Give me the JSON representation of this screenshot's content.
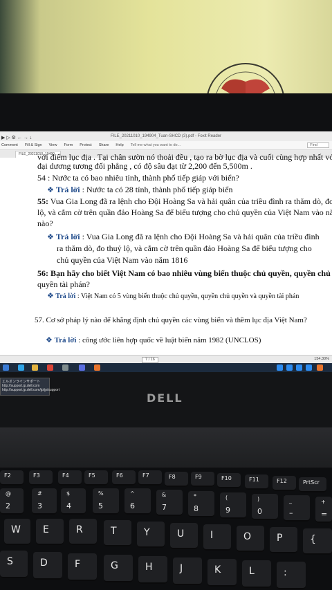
{
  "window": {
    "title": "FILE_20211010_194904_Tuan-SHCD (3).pdf - Foxit Reader",
    "quick_access": "▶ ▷ ⚙ ← → ↓",
    "ribbon_items": [
      "Comment",
      "Fill & Sign",
      "View",
      "Form",
      "Protect",
      "Share",
      "Help"
    ],
    "tell_me": "Tell me what you want to do...",
    "find_placeholder": "Find",
    "tab_label": "FILE_20211010_19490..."
  },
  "document": {
    "line1": "với điểm lục địa . Tại chân sườn nó thoải đều , tạo ra bờ lục địa và cuối cùng hợp nhất với đáy",
    "line2": "đại dương tương đối phẳng , có độ sâu đạt từ 2,200 đến 5,500m .",
    "q54": "54 : Nước ta có bao nhiêu tỉnh, thành phố tiếp giáp với biển?",
    "answer_label": "Trả lời",
    "a54": ": Nước ta có 28 tỉnh, thành phố tiếp giáp biển",
    "q55_num": "55:",
    "q55_l1": "Vua Gia Long đã ra lệnh cho Đội Hoàng Sa và hải quân của triều đình ra thăm dò, đo thuỷ",
    "q55_l2": "lộ, và cắm cờ trên quần đảo Hoàng Sa để biểu tượng cho chủ quyền của Việt Nam vào năm",
    "q55_l3": "nào?",
    "a55_l1": ": Vua Gia Long đã ra lệnh cho Đội Hoàng Sa và hải quân của triều đình",
    "a55_l2": "ra thăm dò, đo thuỷ lộ, và cắm cờ trên quần đảo Hoàng Sa để biểu tượng cho",
    "a55_l3": "chủ quyền của Việt Nam vào năm 1816",
    "q56_l1": "56: Bạn hãy cho biết Việt Nam có bao nhiêu vùng biển thuộc chủ quyền, quyền chủ quyền và",
    "q56_l2": "quyền tài phán?",
    "a56": ": Việt Nam có 5 vùng biển thuộc chủ quyền, quyền chủ quyền và quyền tài phán",
    "q57": "57. Cơ sở pháp lý nào để khẳng định chủ quyền các vùng biển và thềm lục địa Việt Nam?",
    "a57": ": công ước liên hợp quốc về luật biển năm 1982 (UNCLOS)",
    "bullet_glyph": "❖"
  },
  "status": {
    "page": "7 / 16",
    "zoom": "154.30%"
  },
  "popup": {
    "line1": "エルオンラインサポート",
    "line2": "http://support.jp.dell.com",
    "line3": "http://support.jp.dell.com/jp/jp/support"
  },
  "brand": "DELL",
  "keyboard": {
    "fn_row": [
      "F2",
      "F3",
      "F4",
      "F5",
      "F6",
      "F7",
      "F8",
      "F9",
      "F10",
      "F11",
      "F12",
      "PrtScr"
    ],
    "num_row": [
      [
        "@",
        "2"
      ],
      [
        "#",
        "3"
      ],
      [
        "$",
        "4"
      ],
      [
        "%",
        "5"
      ],
      [
        "^",
        "6"
      ],
      [
        "&",
        "7"
      ],
      [
        "*",
        "8"
      ],
      [
        "(",
        "9"
      ],
      [
        ")",
        "0"
      ],
      [
        "_",
        "–"
      ],
      [
        "+",
        "="
      ]
    ],
    "row_q": [
      "W",
      "E",
      "R",
      "T",
      "Y",
      "U",
      "I",
      "O",
      "P",
      "{"
    ],
    "row_a": [
      "S",
      "D",
      "F",
      "G",
      "H",
      "J",
      "K",
      "L",
      ":"
    ]
  },
  "colors": {
    "answer_blue": "#1f4a8a",
    "taskbar": "#1c2b3e"
  }
}
